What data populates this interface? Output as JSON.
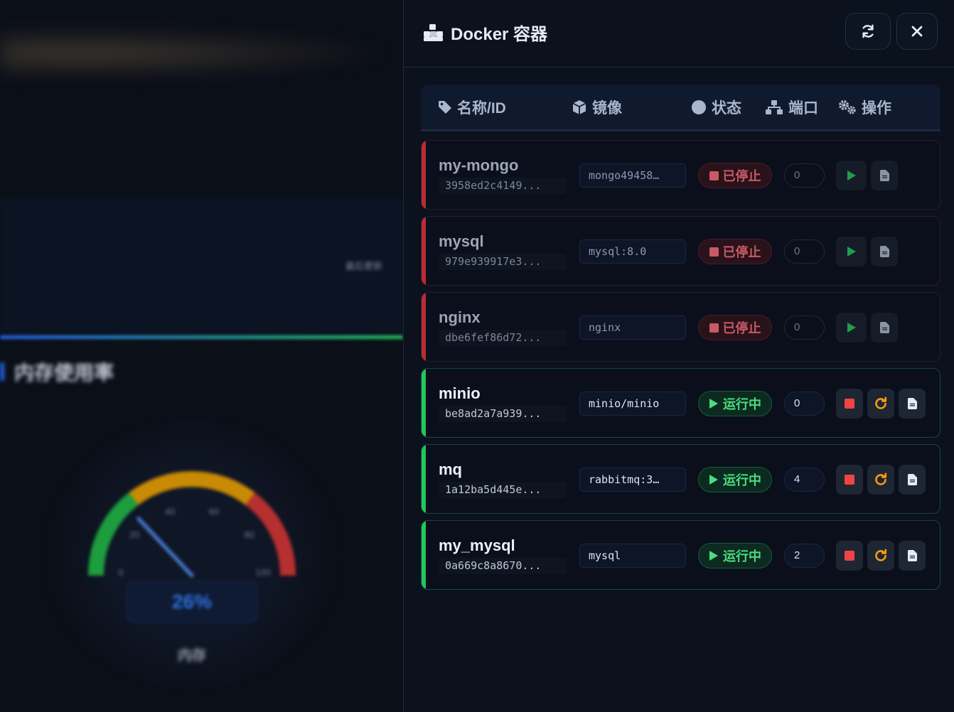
{
  "background": {
    "last_update_text": "最后更新",
    "memory_section_title": "内存使用率",
    "gauge": {
      "value_text": "26%",
      "value_percent": 26,
      "label": "内存",
      "ticks": [
        "0",
        "20",
        "40",
        "60",
        "80",
        "100"
      ]
    }
  },
  "drawer": {
    "title": "Docker 容器",
    "title_icon": "docker-icon",
    "refresh_icon": "refresh-icon",
    "close_icon": "close-icon",
    "columns": [
      {
        "label": "名称/ID",
        "icon": "tag-icon"
      },
      {
        "label": "镜像",
        "icon": "cube-icon"
      },
      {
        "label": "状态",
        "icon": "circle-icon"
      },
      {
        "label": "端口",
        "icon": "network-icon"
      },
      {
        "label": "操作",
        "icon": "gears-icon"
      }
    ],
    "containers": [
      {
        "name": "my-mongo",
        "id": "3958ed2c4149...",
        "image": "mongo49458…",
        "status": "已停止",
        "state": "stopped",
        "ports": "0"
      },
      {
        "name": "mysql",
        "id": "979e939917e3...",
        "image": "mysql:8.0",
        "status": "已停止",
        "state": "stopped",
        "ports": "0"
      },
      {
        "name": "nginx",
        "id": "dbe6fef86d72...",
        "image": "nginx",
        "status": "已停止",
        "state": "stopped",
        "ports": "0"
      },
      {
        "name": "minio",
        "id": "be8ad2a7a939...",
        "image": "minio/minio",
        "status": "运行中",
        "state": "running",
        "ports": "0"
      },
      {
        "name": "mq",
        "id": "1a12ba5d445e...",
        "image": "rabbitmq:3…",
        "status": "运行中",
        "state": "running",
        "ports": "4"
      },
      {
        "name": "my_mysql",
        "id": "0a669c8a8670...",
        "image": "mysql",
        "status": "运行中",
        "state": "running",
        "ports": "2"
      }
    ]
  },
  "colors": {
    "running": "#22c55e",
    "stopped": "#b82d34",
    "play": "#22c55e",
    "stop": "#ef4444",
    "restart": "#f59e0b"
  }
}
